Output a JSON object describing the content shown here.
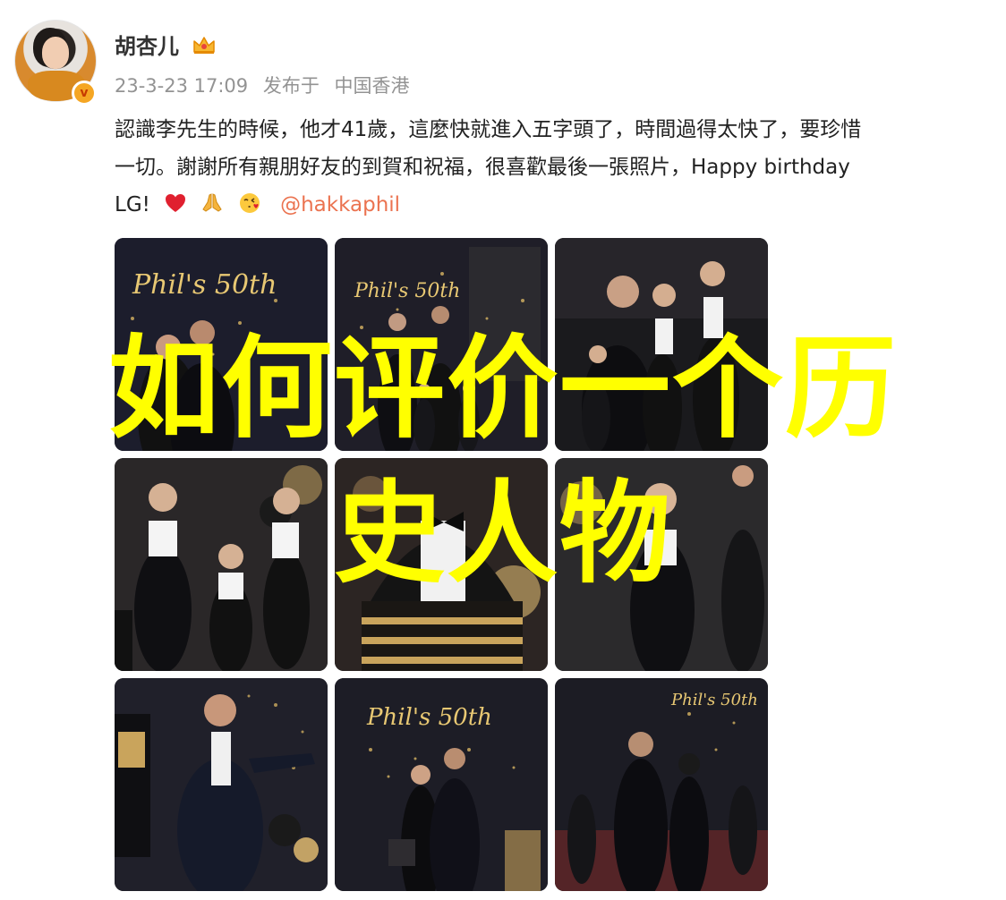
{
  "post": {
    "author": "胡杏儿",
    "timestamp": "23-3-23 17:09",
    "publish_label": "发布于",
    "location": "中国香港",
    "text_line1": "認識李先生的時候，他才41歲，這麼快就進入五字頭了，時間過得太快了，要珍惜",
    "text_line2": "一切。謝謝所有親朋好友的到賀和祝福，很喜歡最後一張照片，Happy birthday",
    "text_line3": "LG!",
    "mention": "@hakkaphil",
    "emojis": [
      "heart-emoji",
      "praying-hands-emoji",
      "kissing-face-emoji"
    ],
    "badges": {
      "crown": "crown-icon",
      "verified": "verified-v-badge"
    },
    "verified_glyph": "v"
  },
  "photos": [
    {
      "name": "photo-1",
      "sign_text": "Phil's 50th"
    },
    {
      "name": "photo-2",
      "sign_text": "Phil's 50th"
    },
    {
      "name": "photo-3",
      "sign_text": ""
    },
    {
      "name": "photo-4",
      "sign_text": ""
    },
    {
      "name": "photo-5",
      "sign_text": ""
    },
    {
      "name": "photo-6",
      "sign_text": ""
    },
    {
      "name": "photo-7",
      "sign_text": ""
    },
    {
      "name": "photo-8",
      "sign_text": "Phil's 50th"
    },
    {
      "name": "photo-9",
      "sign_text": "Phil's 50th"
    }
  ],
  "overlay": {
    "line1": "如何评价一个历",
    "line2": "史人物",
    "color": "#ffff00"
  },
  "colors": {
    "mention": "#eb7350",
    "meta": "#939393",
    "text": "#222222",
    "badge": "#f5a623"
  }
}
